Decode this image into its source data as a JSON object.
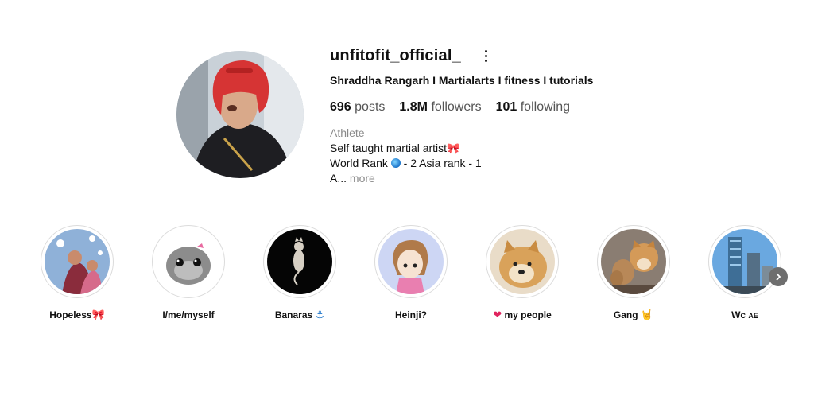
{
  "profile": {
    "username": "unfitofit_official_",
    "full_name": "Shraddha Rangarh I Martialarts I fitness I tutorials",
    "stats": {
      "posts_count": "696",
      "posts_label": "posts",
      "followers_count": "1.8M",
      "followers_label": "followers",
      "following_count": "101",
      "following_label": "following"
    },
    "category": "Athlete",
    "bio_line1": "Self taught martial artist",
    "bio_line2_a": "World Rank",
    "bio_line2_b": "- 2 Asia rank - 1",
    "bio_line3": "A...",
    "more_label": "more"
  },
  "highlights": [
    {
      "label": "Hopeless",
      "emoji": "🎀",
      "icon": "ribbon-icon"
    },
    {
      "label": "I/me/myself",
      "emoji": "",
      "icon": "hamster-image"
    },
    {
      "label": "Banaras",
      "emoji": "⚓",
      "icon": "anchor-icon"
    },
    {
      "label": "Heinji?",
      "emoji": "",
      "icon": "cartoon-image"
    },
    {
      "label": "my people",
      "emoji": "❤",
      "icon": "heart-icon"
    },
    {
      "label": "Gang",
      "emoji": "🤘",
      "icon": "rock-hand-icon"
    },
    {
      "label": "Wc",
      "emoji": "AE",
      "icon": "flag-icon"
    }
  ],
  "colors": {
    "ring": "#dbdbdb",
    "muted_text": "#8a8a8a",
    "ribbon": "#c2185b",
    "heart": "#e0245e"
  }
}
